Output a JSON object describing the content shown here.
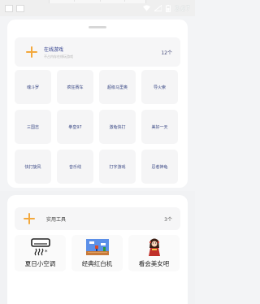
{
  "status_bar": {
    "time": "2:27",
    "icons": [
      "wifi-icon",
      "signal-icon",
      "battery-icon"
    ]
  },
  "online_games": {
    "title": "在线游戏",
    "subtitle": "不占内存在线玩游戏",
    "count": "12个",
    "accent": "#f3a83c",
    "games": [
      "魂斗罗",
      "疯狂赛车",
      "超级马里奥",
      "导火索",
      "三国志",
      "拳皇97",
      "激龟快打",
      "美好一天",
      "快打旋风",
      "音乐线",
      "打字游戏",
      "忍者神龟"
    ]
  },
  "tools": {
    "title": "实用工具",
    "count": "3个",
    "items": [
      {
        "label": "夏日小空调",
        "icon": "air-conditioner-icon"
      },
      {
        "label": "经典红白机",
        "icon": "retro-game-screen-icon"
      },
      {
        "label": "看会美女吧",
        "icon": "beauty-figure-icon"
      }
    ]
  }
}
